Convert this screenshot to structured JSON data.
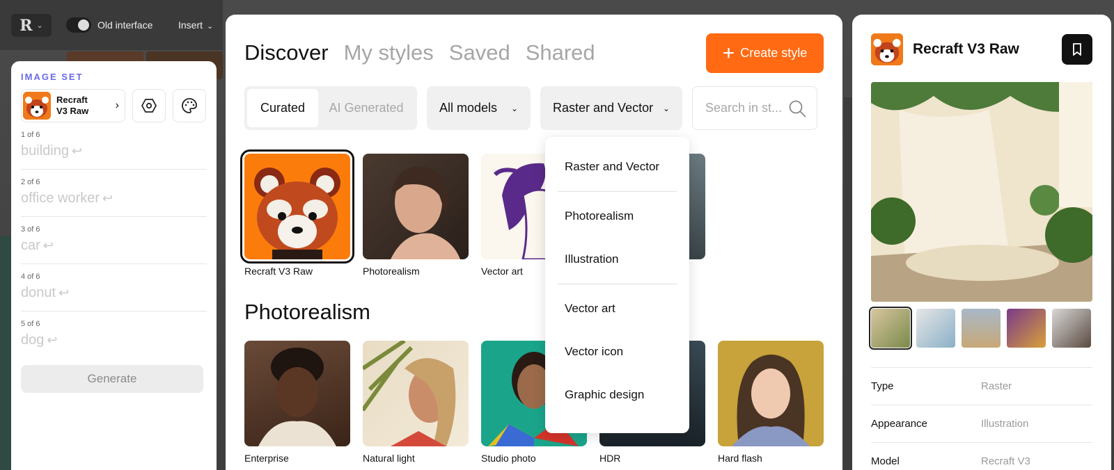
{
  "app": {
    "toggle_label": "Old interface",
    "insert_label": "Insert"
  },
  "image_set": {
    "title": "IMAGE SET",
    "style_name_line1": "Recraft",
    "style_name_line2": "V3 Raw",
    "prompts": [
      {
        "count": "1 of 6",
        "text": "building"
      },
      {
        "count": "2 of 6",
        "text": "office worker"
      },
      {
        "count": "3 of 6",
        "text": "car"
      },
      {
        "count": "4 of 6",
        "text": "donut"
      },
      {
        "count": "5 of 6",
        "text": "dog"
      }
    ],
    "generate_label": "Generate"
  },
  "styles_modal": {
    "tabs": [
      "Discover",
      "My styles",
      "Saved",
      "Shared"
    ],
    "active_tab": "Discover",
    "create_label": "Create style",
    "segment": {
      "curated": "Curated",
      "ai_generated": "AI Generated"
    },
    "models_filter": "All models",
    "type_filter": "Raster and Vector",
    "search_placeholder": "Search in st...",
    "curated_row": [
      {
        "label": "Recraft V3 Raw",
        "selected": true
      },
      {
        "label": "Photorealism"
      },
      {
        "label": "Vector art"
      }
    ],
    "section_title": "Photorealism",
    "photo_row": [
      {
        "label": "Enterprise"
      },
      {
        "label": "Natural light"
      },
      {
        "label": "Studio photo"
      },
      {
        "label": "HDR"
      },
      {
        "label": "Hard flash"
      }
    ],
    "type_menu": [
      "Raster and Vector",
      "Photorealism",
      "Illustration",
      "Vector art",
      "Vector icon",
      "Graphic design"
    ]
  },
  "style_detail": {
    "title": "Recraft V3 Raw",
    "properties": [
      {
        "key": "Type",
        "value": "Raster"
      },
      {
        "key": "Appearance",
        "value": "Illustration"
      },
      {
        "key": "Model",
        "value": "Recraft V3"
      }
    ]
  },
  "colors": {
    "accent_orange": "#ff6a13",
    "image_set_title": "#6a6ae8"
  }
}
